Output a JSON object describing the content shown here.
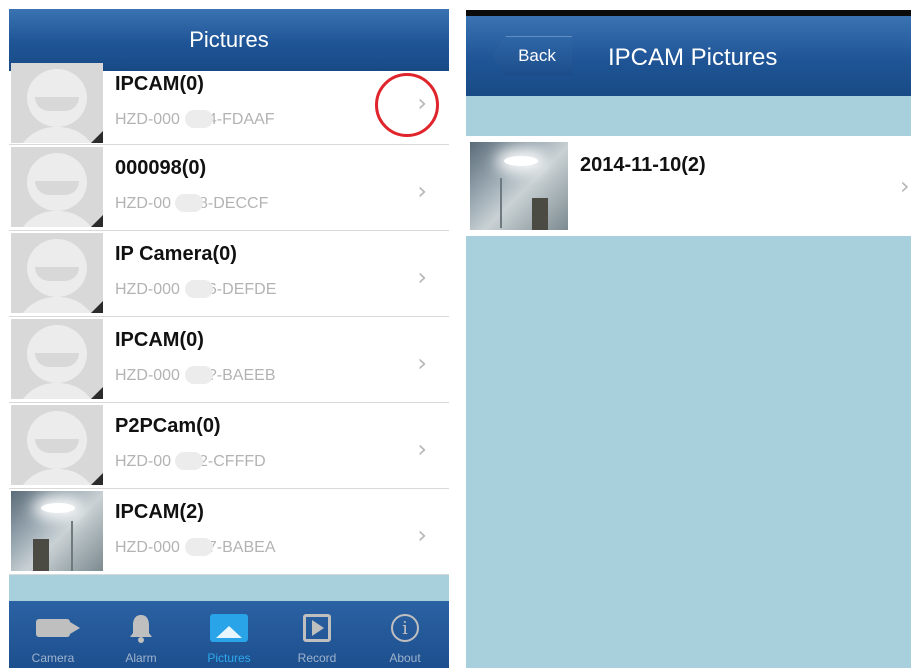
{
  "left_screen": {
    "nav_title": "Pictures",
    "cameras": [
      {
        "name": "IPCAM(0)",
        "id_prefix": "HZD-000",
        "id_suffix": "4-FDAAF",
        "thumbnail": "default-avatar"
      },
      {
        "name": "000098(0)",
        "id_prefix": "HZD-00",
        "id_suffix": "8-DECCF",
        "thumbnail": "default-avatar"
      },
      {
        "name": "IP Camera(0)",
        "id_prefix": "HZD-000",
        "id_suffix": "6-DEFDE",
        "thumbnail": "default-avatar"
      },
      {
        "name": "IPCAM(0)",
        "id_prefix": "HZD-000",
        "id_suffix": "?-BAEEB",
        "thumbnail": "default-avatar"
      },
      {
        "name": "P2PCam(0)",
        "id_prefix": "HZD-00",
        "id_suffix": "2-CFFFD",
        "thumbnail": "default-avatar"
      },
      {
        "name": "IPCAM(2)",
        "id_prefix": "HZD-000",
        "id_suffix": "7-BABEA",
        "thumbnail": "room-photo"
      }
    ],
    "chevron": "›",
    "tabs": [
      {
        "label": "Camera",
        "icon": "camera-icon"
      },
      {
        "label": "Alarm",
        "icon": "bell-icon"
      },
      {
        "label": "Pictures",
        "icon": "pictures-icon",
        "active": true
      },
      {
        "label": "Record",
        "icon": "record-icon"
      },
      {
        "label": "About",
        "icon": "info-icon"
      }
    ],
    "active_tab_color": "#2da9ec",
    "highlight_color": "#e0242c"
  },
  "right_screen": {
    "back_label": "Back",
    "nav_title": "IPCAM Pictures",
    "entries": [
      {
        "date": "2014-11-10(2)",
        "thumbnail": "room-photo"
      }
    ],
    "chevron": "›"
  },
  "colors": {
    "nav_bar": "#1f5596",
    "background": "#a8cfdc",
    "subtitle": "#b3b3b3"
  }
}
